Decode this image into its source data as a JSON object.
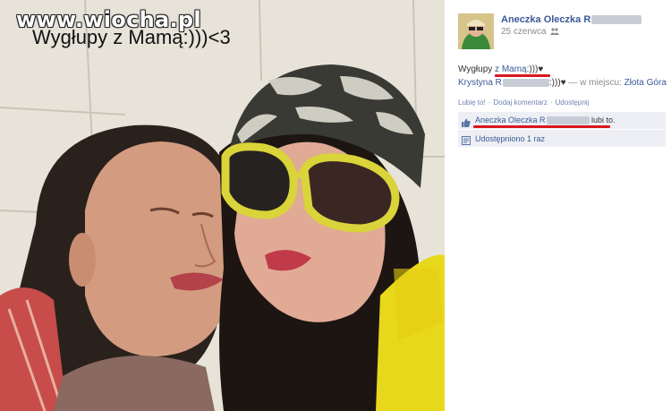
{
  "photo": {
    "watermark": "www.wiocha.pl",
    "caption": "Wygłupy z Mamą:)))<3"
  },
  "post": {
    "author_name": "Aneczka Oleczka R",
    "date": "25 czerwca",
    "privacy_icon": "people-icon",
    "text_prefix": "Wygłupy ",
    "text_link": "z Mamą",
    "text_suffix": ":)))♥",
    "tagged_name": "Krystyna R",
    "tagged_suffix": ":)))♥",
    "location_prefix": "— w miejscu:",
    "location": "Złota Góra"
  },
  "actions": {
    "like": "Lubię to!",
    "comment": "Dodaj komentarz",
    "share": "Udostępnij",
    "separator": "·"
  },
  "likes": {
    "name": "Aneczka Oleczka R",
    "suffix": "lubi to.",
    "icon": "thumbs-up-icon"
  },
  "shares": {
    "text": "Udostępniono 1 raz",
    "icon": "share-icon"
  },
  "colors": {
    "link": "#3b5998",
    "highlight_underline": "#d9181e",
    "panel": "#edeff4"
  }
}
